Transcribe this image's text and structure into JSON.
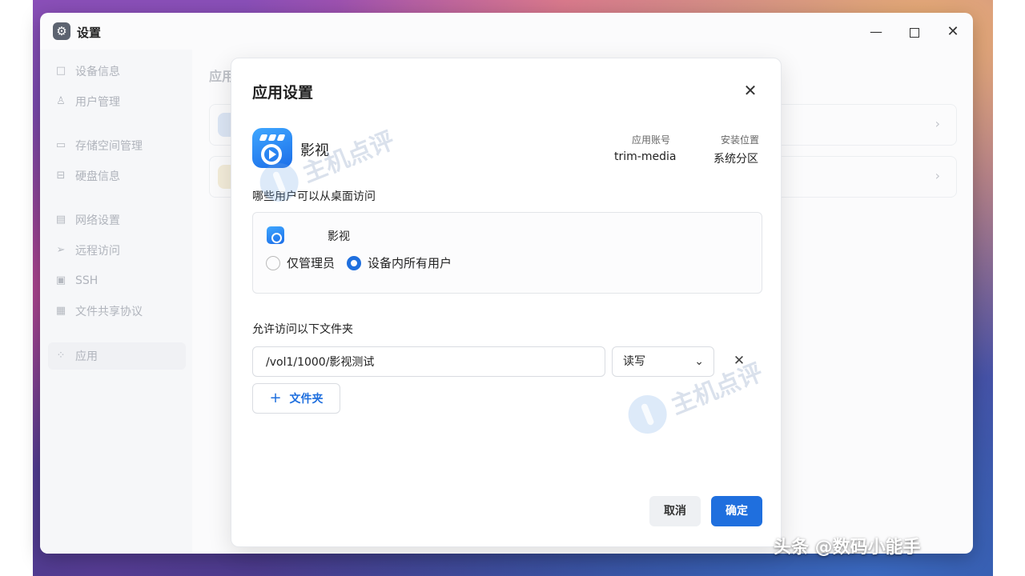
{
  "window": {
    "title": "设置",
    "minimize": "—",
    "close": "✕"
  },
  "sidebar": {
    "items": [
      {
        "label": "设备信息",
        "icon": "□"
      },
      {
        "label": "用户管理",
        "icon": "♙"
      },
      {
        "label": "存储空间管理",
        "icon": "▭"
      },
      {
        "label": "硬盘信息",
        "icon": "⊟"
      },
      {
        "label": "网络设置",
        "icon": "▤"
      },
      {
        "label": "远程访问",
        "icon": "➢"
      },
      {
        "label": "SSH",
        "icon": "▣"
      },
      {
        "label": "文件共享协议",
        "icon": "▦"
      },
      {
        "label": "应用",
        "icon": "⁘"
      }
    ]
  },
  "main": {
    "title": "应用",
    "chevron": "›"
  },
  "dialog": {
    "title": "应用设置",
    "close": "✕",
    "app_name": "影视",
    "account_label": "应用账号",
    "account_value": "trim-media",
    "location_label": "安装位置",
    "location_value": "系统分区",
    "access_label": "哪些用户可以从桌面访问",
    "access_app_name": "影视",
    "radio_admin": "仅管理员",
    "radio_all": "设备内所有用户",
    "selected_option": "设备内所有用户",
    "folders_label": "允许访问以下文件夹",
    "folder_path": "/vol1/1000/影视测试",
    "permission": "读写",
    "permission_chevron": "⌄",
    "remove_icon": "✕",
    "add_folder_plus": "+",
    "add_folder_label": "文件夹",
    "cancel": "取消",
    "confirm": "确定"
  },
  "watermark": "主机点评",
  "credit": "头条 @数码小能手",
  "colors": {
    "accent": "#1f6fde",
    "app_icon": "#2b8af2"
  }
}
